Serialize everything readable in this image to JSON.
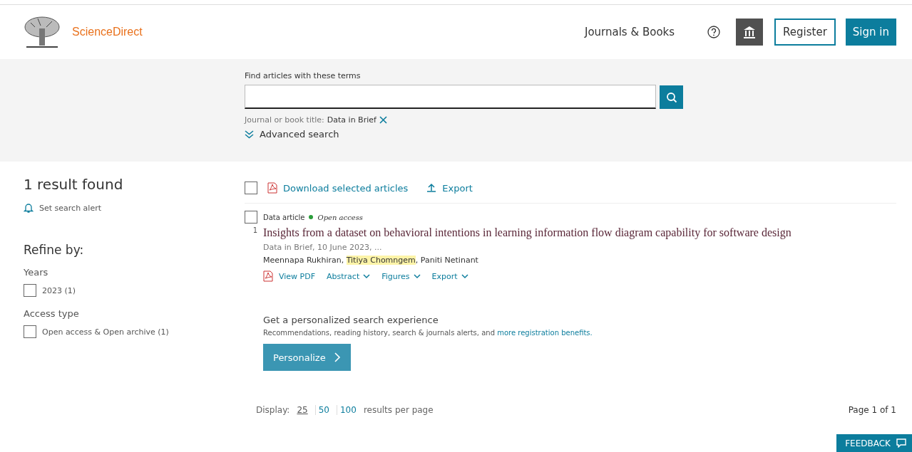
{
  "header": {
    "brand": "ScienceDirect",
    "nav": "Journals & Books",
    "register": "Register",
    "sign_in": "Sign in"
  },
  "search": {
    "label": "Find articles with these terms",
    "filter_label": "Journal or book title:",
    "filter_value": "Data in Brief",
    "advanced": "Advanced search"
  },
  "sidebar": {
    "count": "1 result found",
    "alert": "Set search alert",
    "refine": "Refine by:",
    "groups": [
      {
        "title": "Years",
        "options": [
          {
            "label": "2023 (1)",
            "checked": false
          }
        ]
      },
      {
        "title": "Access type",
        "options": [
          {
            "label": "Open access & Open archive (1)",
            "checked": false
          }
        ]
      }
    ]
  },
  "toolbar": {
    "checked": false,
    "download": "Download selected articles",
    "export": "Export"
  },
  "results": [
    {
      "checked": false,
      "type": "Data article",
      "access": "Open access",
      "number": "1",
      "title": "Insights from a dataset on behavioral intentions in learning information flow diagram capability for software design",
      "source": "Data in Brief, 10 June 2023, ...",
      "author_separator": ",",
      "authors": [
        {
          "name": "Meennapa Rukhiran",
          "highlighted": false
        },
        {
          "name": "Titiya Chomngem",
          "highlighted": true
        },
        {
          "name": "Paniti Netinant",
          "highlighted": false
        }
      ],
      "actions": [
        {
          "label": "View PDF",
          "kind": "pdf"
        },
        {
          "label": "Abstract",
          "kind": "dropdown"
        },
        {
          "label": "Figures",
          "kind": "dropdown"
        },
        {
          "label": "Export",
          "kind": "dropdown"
        }
      ]
    }
  ],
  "promo": {
    "title": "Get a personalized search experience",
    "text": "Recommendations, reading history, search & journals alerts, and",
    "link": "more registration benefits.",
    "button": "Personalize"
  },
  "pagination": {
    "display": "Display:",
    "sizes": [
      {
        "label": "25",
        "selected": true
      },
      {
        "label": "50",
        "selected": false
      },
      {
        "label": "100",
        "selected": false
      }
    ],
    "suffix": "results per page",
    "page": "Page 1 of 1"
  },
  "feedback": "FEEDBACK"
}
